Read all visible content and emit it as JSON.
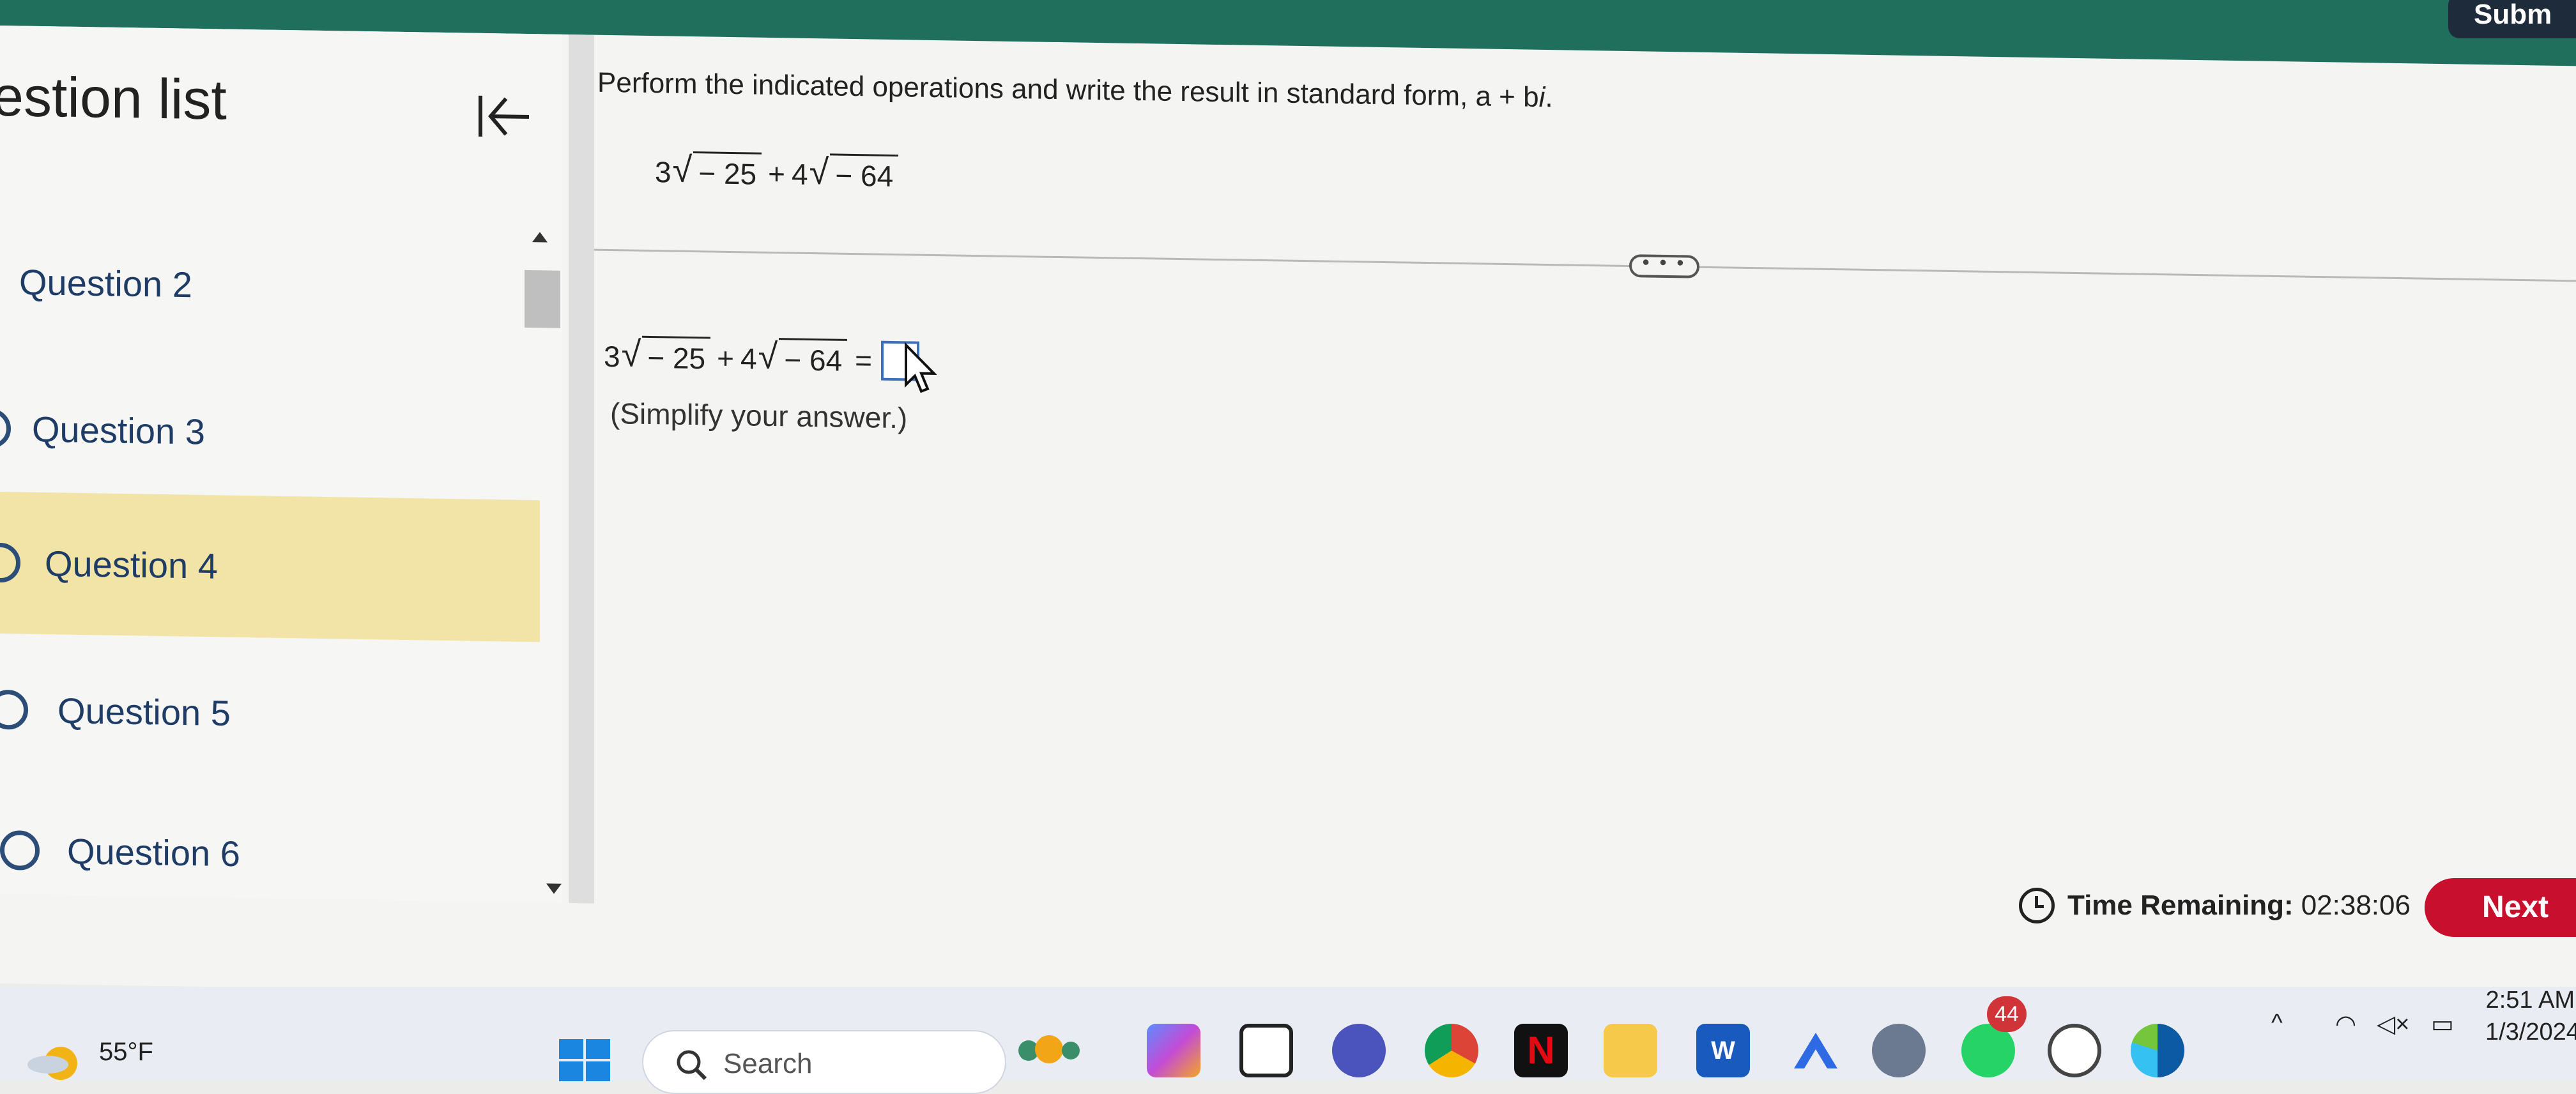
{
  "header": {
    "submit_label": "Subm"
  },
  "sidebar": {
    "title": "estion list",
    "items": [
      {
        "label": "Question 2"
      },
      {
        "label": "Question 3"
      },
      {
        "label": "Question 4",
        "active": true
      },
      {
        "label": "Question 5"
      },
      {
        "label": "Question 6"
      }
    ]
  },
  "question": {
    "prompt_main": "Perform the indicated operations and write the result in standard form, a + b",
    "prompt_i": "i",
    "prompt_end": ".",
    "expr": {
      "c1": "3",
      "r1": "− 25",
      "plus": "+",
      "c2": "4",
      "r2": "− 64",
      "equals": "="
    },
    "more_label": "• • •",
    "hint": "(Simplify your answer.)"
  },
  "footer": {
    "time_label": "Time Remaining:",
    "time_value": "02:38:06",
    "next_label": "Next"
  },
  "taskbar": {
    "temperature": "55°F",
    "search_placeholder": "Search",
    "badge_count": "44",
    "clock_time": "2:51 AM",
    "clock_date": "1/3/2024"
  },
  "colors": {
    "accent": "#1f6f5c",
    "active_item": "#f1e4a6",
    "next": "#c8102e",
    "link": "#1e3c66"
  }
}
